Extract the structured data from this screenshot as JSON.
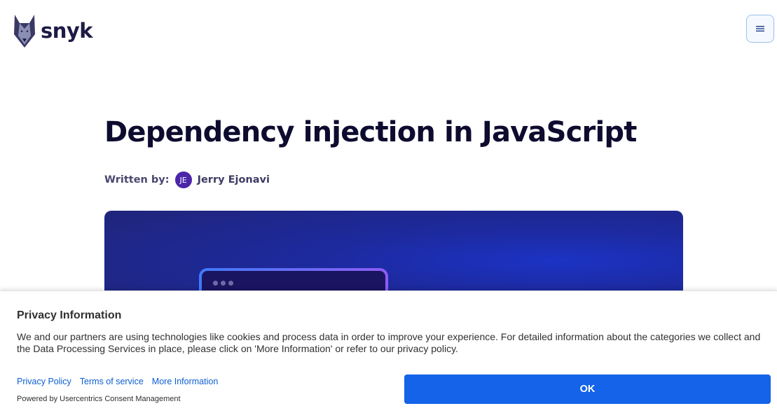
{
  "header": {
    "logo_text": "snyk",
    "menu_icon": "hamburger-icon"
  },
  "article": {
    "title": "Dependency injection in JavaScript",
    "byline_label": "Written by:",
    "author_initials": "JE",
    "author_name": "Jerry Ejonavi"
  },
  "consent": {
    "title": "Privacy Information",
    "body": "We and our partners are using technologies like cookies and process data in order to improve your experience. For detailed information about the categories we collect and the Data Processing Services in place, please click on 'More Information' or refer to our privacy policy.",
    "links": [
      "Privacy Policy",
      "Terms of service",
      "More Information"
    ],
    "powered_by": "Powered by Usercentrics Consent Management",
    "ok_label": "OK"
  },
  "colors": {
    "brand_dark": "#1d1b46",
    "avatar": "#4b26a8",
    "ok_button": "#1463e8",
    "link": "#0d5ed1"
  }
}
